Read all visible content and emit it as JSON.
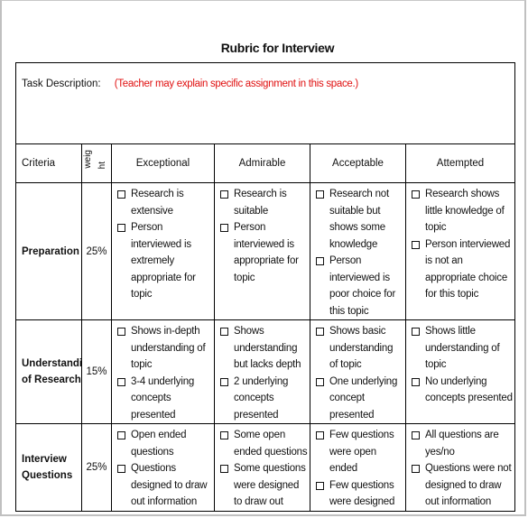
{
  "title": "Rubric for Interview",
  "task": {
    "label": "Task Description:",
    "hint": "(Teacher may explain specific assignment in this space.)"
  },
  "header": {
    "criteria": "Criteria",
    "weight_line1": "weig",
    "weight_line2": "ht",
    "levels": [
      "Exceptional",
      "Admirable",
      "Acceptable",
      "Attempted"
    ]
  },
  "colors": {
    "hint": "#e01010",
    "border": "#000000"
  },
  "rows": [
    {
      "criterion": "Preparation",
      "weight": "25%",
      "cells": [
        [
          "Research is extensive",
          "Person interviewed is extremely appropriate for topic"
        ],
        [
          "Research is suitable",
          "Person interviewed is appropriate for topic"
        ],
        [
          "Research not suitable but shows some knowledge",
          "Person interviewed is poor choice for this topic"
        ],
        [
          "Research shows little knowledge of topic",
          "Person interviewed is not an appropriate choice for this topic"
        ]
      ]
    },
    {
      "criterion": "Understandi of Research",
      "weight": "15%",
      "cells": [
        [
          "Shows in-depth understanding of topic",
          "3-4 underlying concepts presented"
        ],
        [
          "Shows understanding but lacks depth",
          "2 underlying concepts presented"
        ],
        [
          "Shows basic understanding of topic",
          "One underlying concept presented"
        ],
        [
          "Shows little understanding of topic",
          "No underlying concepts presented"
        ]
      ]
    },
    {
      "criterion": "Interview Questions",
      "weight": "25%",
      "cells": [
        [
          "Open ended questions",
          "Questions designed to draw out information"
        ],
        [
          "Some open ended questions",
          "Some questions were designed to draw out"
        ],
        [
          "Few questions were open ended",
          "Few questions were designed"
        ],
        [
          "All questions are yes/no",
          "Questions were not designed to draw out information"
        ]
      ]
    }
  ]
}
